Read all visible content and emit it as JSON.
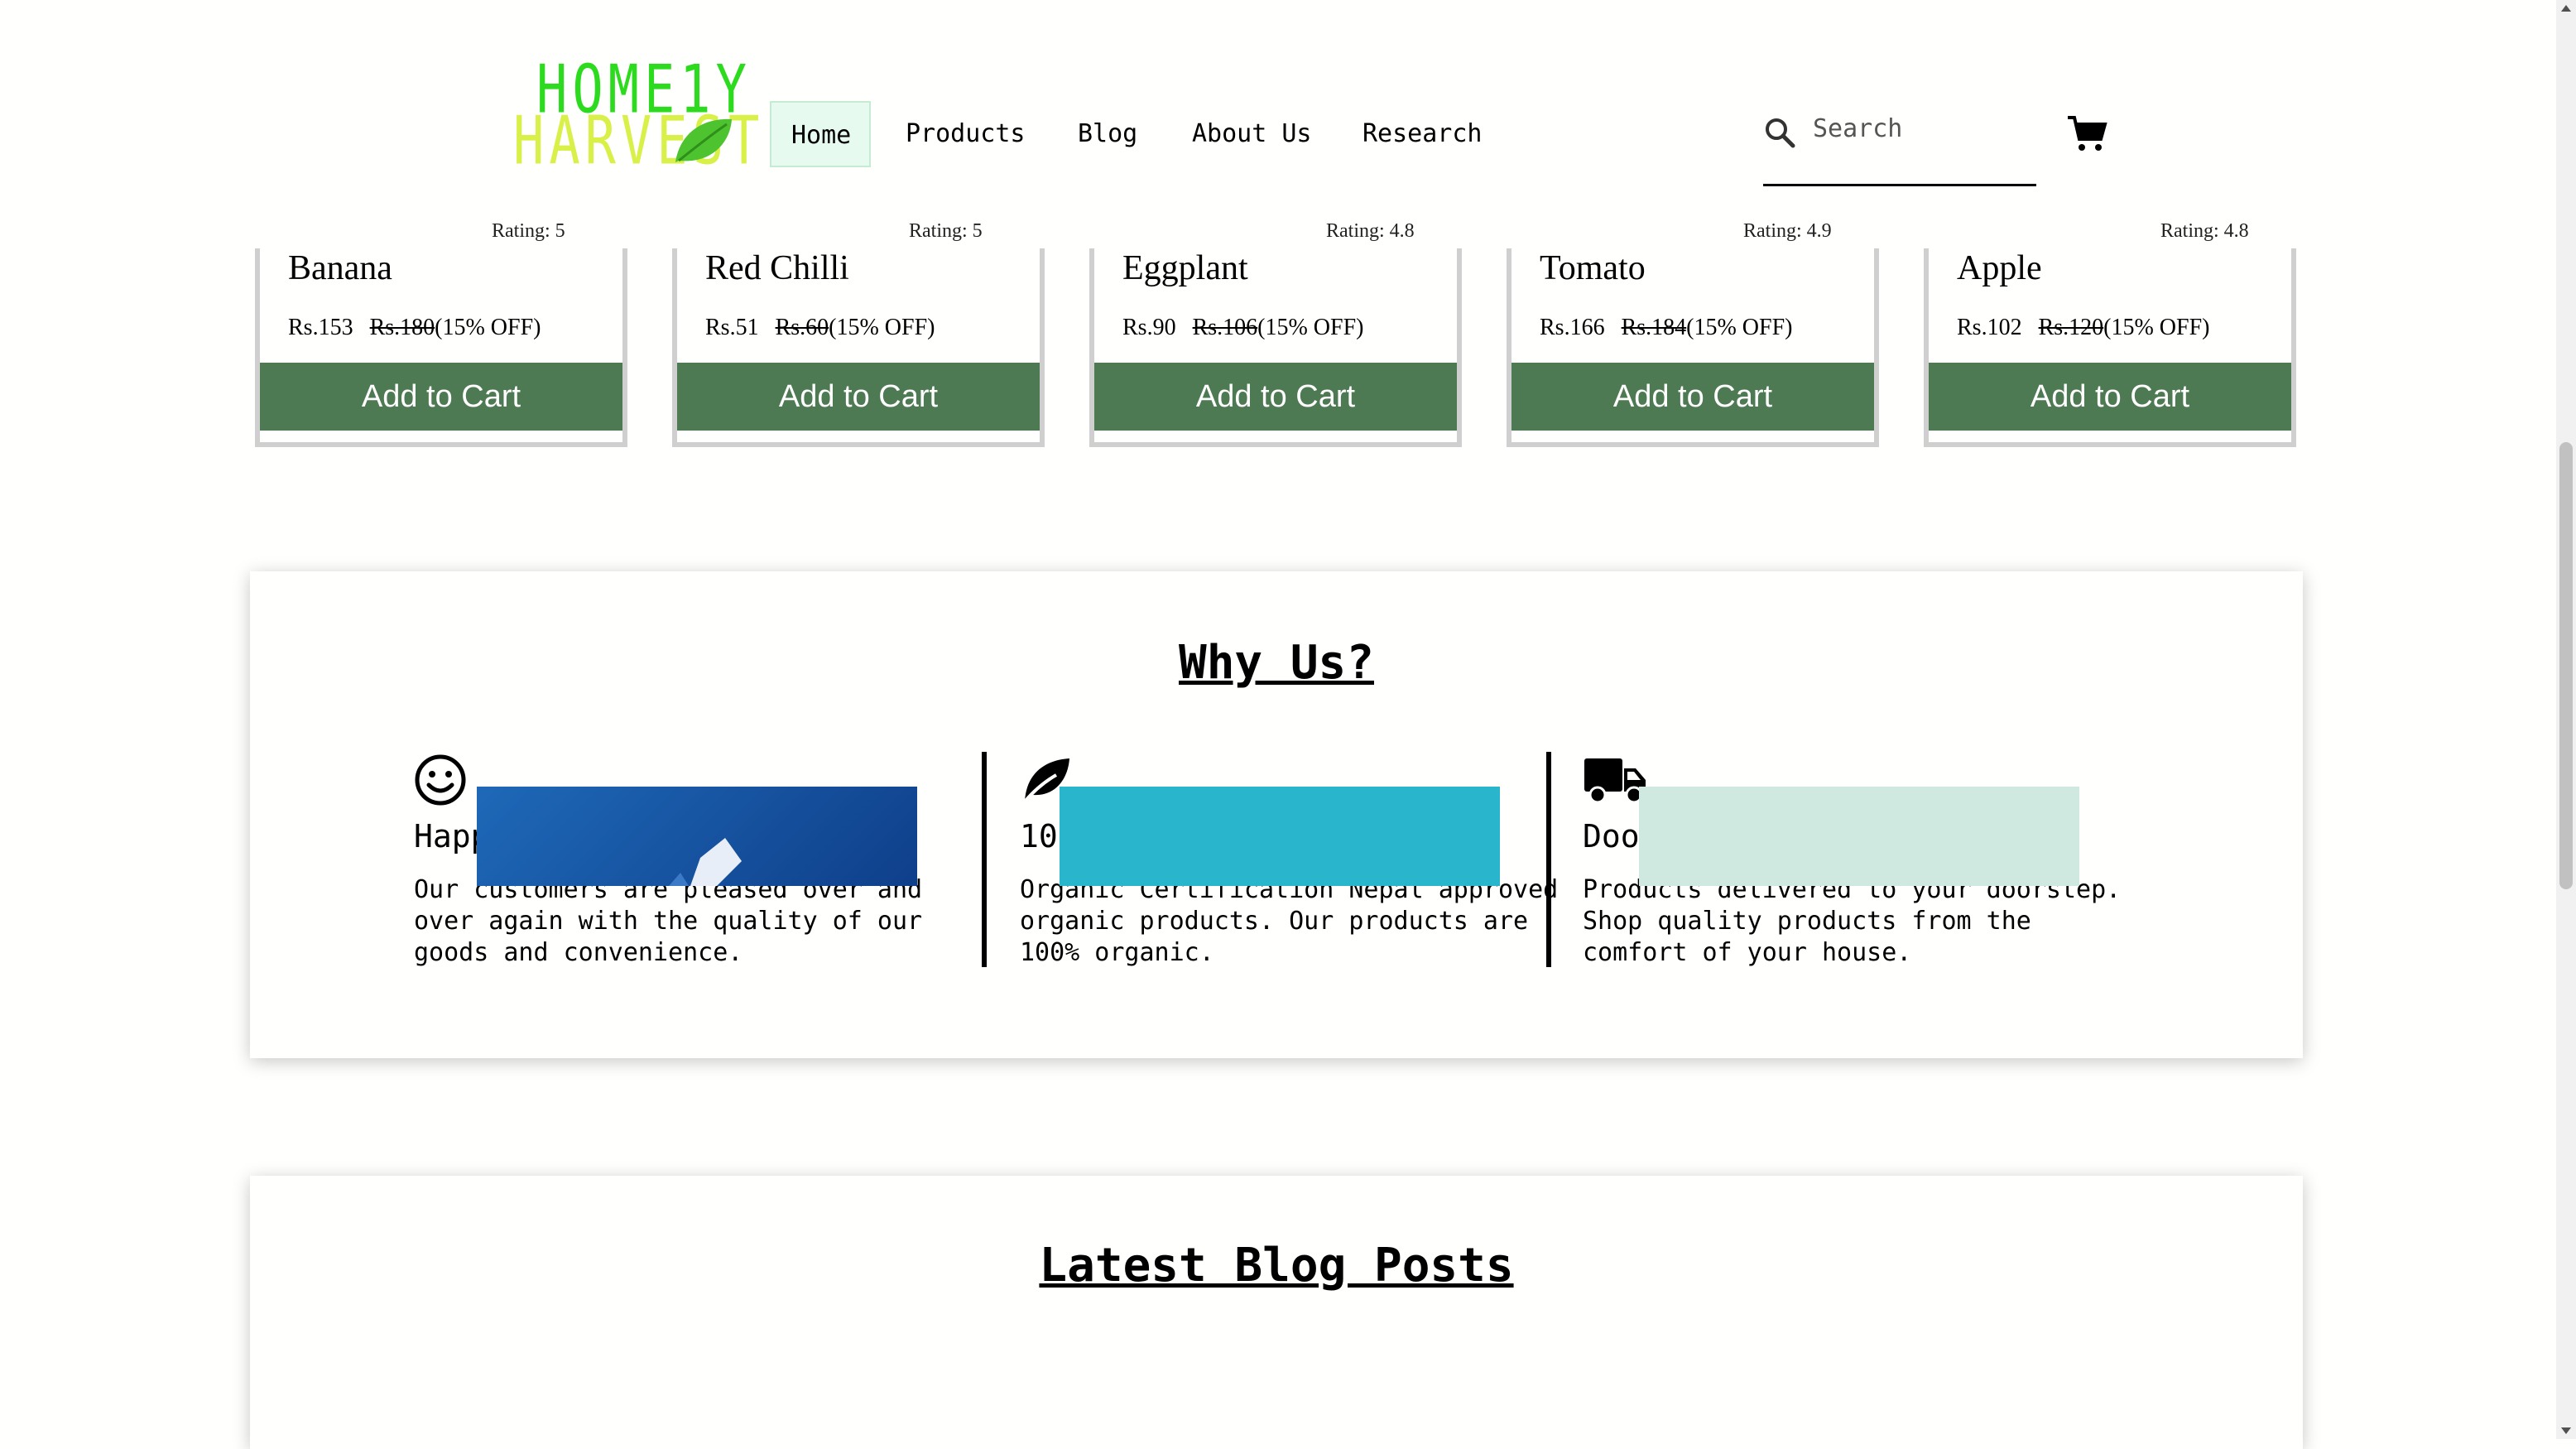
{
  "brand": {
    "line1": "HOME1Y",
    "line2": "HARVEST"
  },
  "nav": {
    "items": [
      {
        "label": "Home",
        "active": true
      },
      {
        "label": "Products"
      },
      {
        "label": "Blog"
      },
      {
        "label": "About Us"
      },
      {
        "label": "Research"
      }
    ]
  },
  "search": {
    "placeholder": "Search"
  },
  "products": [
    {
      "rating": "Rating: 5",
      "name": "Banana",
      "price": "Rs.153",
      "old_price": "Rs.180",
      "discount": "(15% OFF)",
      "button": "Add to Cart"
    },
    {
      "rating": "Rating: 5",
      "name": "Red Chilli",
      "price": "Rs.51",
      "old_price": "Rs.60",
      "discount": "(15% OFF)",
      "button": "Add to Cart"
    },
    {
      "rating": "Rating: 4.8",
      "name": "Eggplant",
      "price": "Rs.90",
      "old_price": "Rs.106",
      "discount": "(15% OFF)",
      "button": "Add to Cart"
    },
    {
      "rating": "Rating: 4.9",
      "name": "Tomato",
      "price": "Rs.166",
      "old_price": "Rs.184",
      "discount": "(15% OFF)",
      "button": "Add to Cart"
    },
    {
      "rating": "Rating: 4.8",
      "name": "Apple",
      "price": "Rs.102",
      "old_price": "Rs.120",
      "discount": "(15% OFF)",
      "button": "Add to Cart"
    }
  ],
  "why_us": {
    "title": "Why Us?",
    "features": [
      {
        "icon": "smiley-icon",
        "title": "Happy Customers",
        "desc": "Our customers are pleased over and over again with the quality of our goods and convenience."
      },
      {
        "icon": "leaf-icon",
        "title": "100% Organic",
        "desc": "Organic Certification Nepal approved organic products. Our products are 100% organic."
      },
      {
        "icon": "truck-icon",
        "title": "Doorstep Delivery",
        "desc": "Products delivered to your doorstep. Shop quality products from the comfort of your house."
      }
    ]
  },
  "blog": {
    "title": "Latest Blog Posts"
  },
  "colors": {
    "accent_green": "#4d7a52",
    "logo_green": "#2cdb1e",
    "logo_yellow": "#d8f047",
    "nav_active_bg": "#e6faef"
  }
}
